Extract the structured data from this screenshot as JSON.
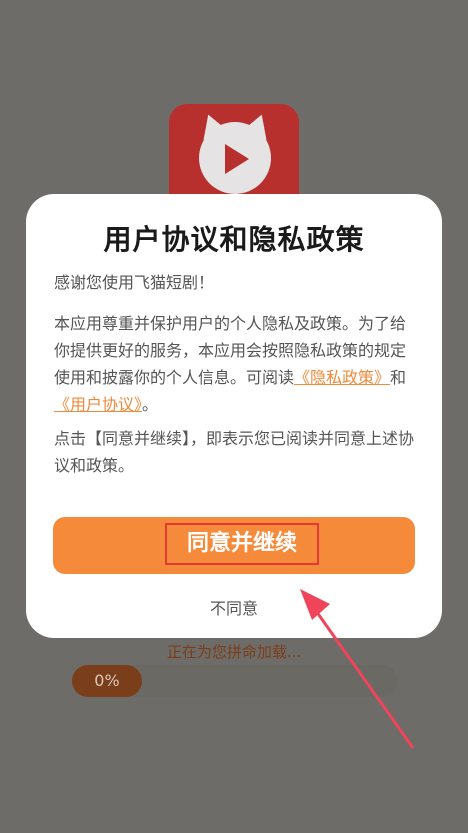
{
  "background": {
    "loading_text": "正在为您拼命加载...",
    "progress_label": "0%",
    "progress_value": 0
  },
  "dialog": {
    "title": "用户协议和隐私政策",
    "greeting": "感谢您使用飞猫短剧！",
    "body_part1": "本应用尊重并保护用户的个人隐私及政策。为了给你提供更好的服务，本应用会按照隐私政策的规定使用和披露你的个人信息。可阅读",
    "privacy_link": "《隐私政策》",
    "and_text": "和",
    "user_agreement_link": "《用户协议》",
    "body_end": "。",
    "note": "点击【同意并继续】，即表示您已阅读并同意上述协议和政策。",
    "agree_button": "同意并继续",
    "disagree_button": "不同意"
  },
  "colors": {
    "accent": "#f58a3a",
    "link": "#f08a3b",
    "highlight_box": "#e53935",
    "arrow": "#f0445a",
    "overlay": "#6e6c68"
  }
}
